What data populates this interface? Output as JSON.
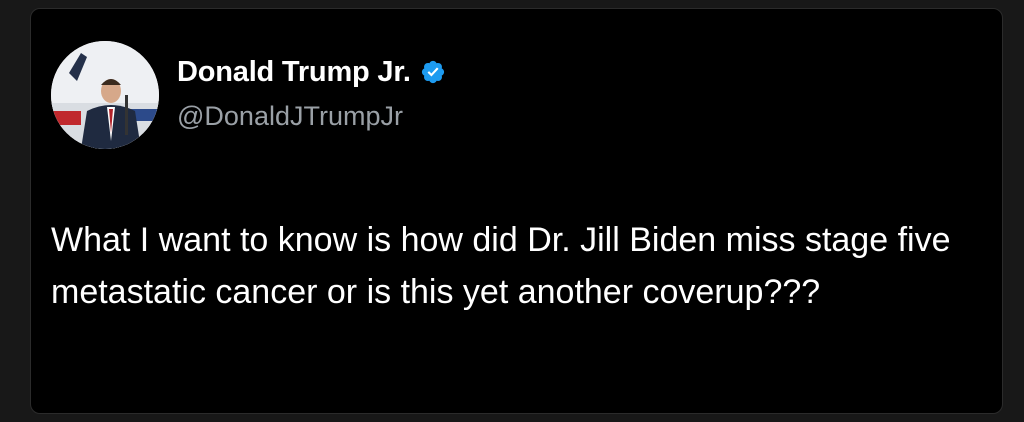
{
  "tweet": {
    "author": {
      "display_name": "Donald Trump Jr.",
      "handle": "@DonaldJTrumpJr",
      "verified": true,
      "verified_icon": "verified-badge-icon",
      "verified_color": "#1d9bf0"
    },
    "text": "What I want to know is how did Dr. Jill Biden miss stage five metastatic cancer or is this yet another coverup???"
  },
  "colors": {
    "background": "#000000",
    "page": "#181818",
    "text": "#ffffff",
    "handle": "#9aa0a6"
  }
}
